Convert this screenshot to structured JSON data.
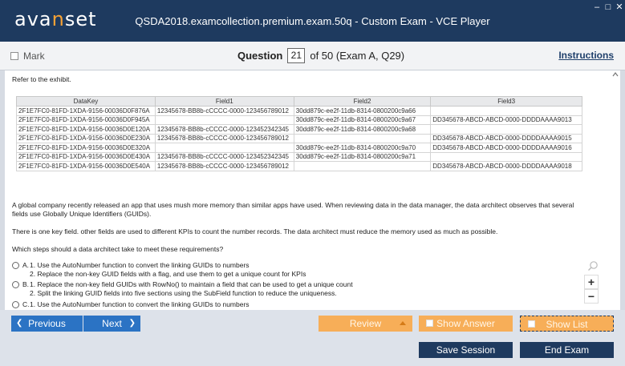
{
  "titlebar": {
    "logo_pre": "ava",
    "logo_accent": "n",
    "logo_post": "set",
    "title": "QSDA2018.examcollection.premium.exam.50q - Custom Exam - VCE Player",
    "min": "–",
    "max": "□",
    "close": "✕"
  },
  "header": {
    "mark_label": "Mark",
    "question_label": "Question",
    "question_number": "21",
    "question_of": "of 50 (Exam A, Q29)",
    "instructions": "Instructions"
  },
  "content": {
    "intro": "Refer to the exhibit.",
    "table": {
      "headers": [
        "DataKey",
        "Field1",
        "Field2",
        "Field3"
      ],
      "rows": [
        [
          "2F1E7FC0-81FD-1XDA-9156-00036D0F876A",
          "12345678-BB8b-cCCCC-0000-123456789012",
          "30dd879c-ee2f-11db-8314-0800200c9a66",
          ""
        ],
        [
          "2F1E7FC0-81FD-1XDA-9156-00036D0F945A",
          "",
          "30dd879c-ee2f-11db-8314-0800200c9a67",
          "DD345678-ABCD-ABCD-0000-DDDDAAAA9013"
        ],
        [
          "2F1E7FC0-81FD-1XDA-9156-00036D0E120A",
          "12345678-BB8b-cCCCC-0000-123452342345",
          "30dd879c-ee2f-11db-8314-0800200c9a68",
          ""
        ],
        [
          "2F1E7FC0-81FD-1XDA-9156-00036D0E230A",
          "12345678-BB8b-cCCCC-0000-123456789012",
          "",
          "DD345678-ABCD-ABCD-0000-DDDDAAAA9015"
        ],
        [
          "2F1E7FC0-81FD-1XDA-9156-00036D0E320A",
          "",
          "30dd879c-ee2f-11db-8314-0800200c9a70",
          "DD345678-ABCD-ABCD-0000-DDDDAAAA9016"
        ],
        [
          "2F1E7FC0-81FD-1XDA-9156-00036D0E430A",
          "12345678-BB8b-cCCCC-0000-123452342345",
          "30dd879c-ee2f-11db-8314-0800200c9a71",
          ""
        ],
        [
          "2F1E7FC0-81FD-1XDA-9156-00036D0E540A",
          "12345678-BB8b-cCCCC-0000-123456789012",
          "",
          "DD345678-ABCD-ABCD-0000-DDDDAAAA9018"
        ]
      ]
    },
    "question_p1_l1": "A global company recently released an app that uses mush more memory than similar apps have used. When reviewing data in the data manager, the data architect observes that several",
    "question_p1_l2": "fields use Globally Unique Identifiers (GUIDs).",
    "question_p2": "There is one key field. other fields are used to different KPIs to count the number records. The data architect must reduce the memory used as much as possible.",
    "question_p3": "Which steps should a data architect take to meet these requirements?",
    "options": [
      {
        "letter": "A.",
        "line1": "1. Use the AutoNumber function to convert the linking GUIDs to numbers",
        "line2": "2. Replace the non-key GUID fields with a flag, and use them to get a unique count for KPIs"
      },
      {
        "letter": "B.",
        "line1": "1. Replace the non-key field GUIDs with RowNo() to maintain a field that can be used to get a unique count",
        "line2": "2. Split the linking GUID fields into five sections using the SubField function to reduce the uniqueness."
      },
      {
        "letter": "C.",
        "line1": "1. Use the AutoNumber function to convert the linking GUIDs to numbers",
        "line2": ""
      }
    ],
    "zoom_in": "+",
    "zoom_out": "−"
  },
  "footer": {
    "previous": "Previous",
    "next": "Next",
    "review": "Review",
    "show_answer": "Show Answer",
    "show_list": "Show List",
    "save_session": "Save Session",
    "end_exam": "End Exam"
  },
  "colors": {
    "titlebar": "#1e3a5f",
    "accent": "#f7a235",
    "nav_button": "#2b73c4",
    "orange_button": "#f7ae58"
  },
  "icons": [
    "search-icon",
    "scroll-up-icon",
    "chevron-left-icon",
    "chevron-right-icon",
    "arrow-up-icon"
  ]
}
